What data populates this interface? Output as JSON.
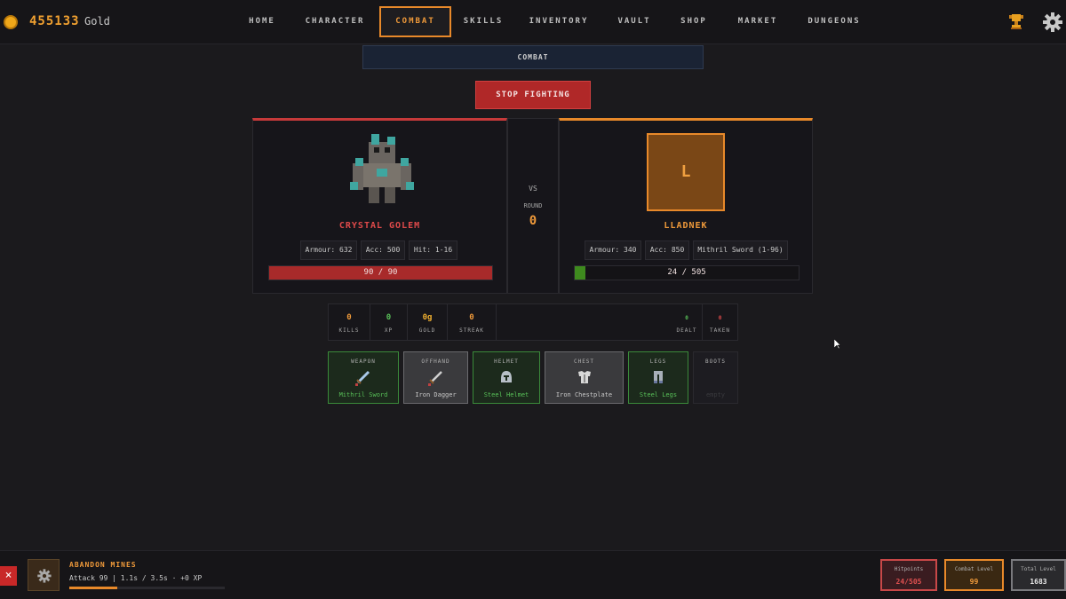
{
  "header": {
    "gold_amount": "455133",
    "gold_label": "Gold",
    "nav": [
      {
        "label": "HOME",
        "active": false
      },
      {
        "label": "CHARACTER",
        "active": false
      },
      {
        "label": "COMBAT",
        "active": true
      },
      {
        "label": "SKILLS",
        "active": false
      },
      {
        "label": "INVENTORY",
        "active": false
      },
      {
        "label": "VAULT",
        "active": false
      },
      {
        "label": "SHOP",
        "active": false
      },
      {
        "label": "MARKET",
        "active": false
      },
      {
        "label": "DUNGEONS",
        "active": false
      }
    ]
  },
  "combat": {
    "header_title": "COMBAT",
    "stop_label": "STOP FIGHTING",
    "vs_label": "VS",
    "round_label": "ROUND",
    "round_value": "0",
    "enemy": {
      "name": "CRYSTAL GOLEM",
      "armour": "Armour: 632",
      "acc": "Acc: 500",
      "hit": "Hit: 1-16",
      "hp_text": "90 / 90",
      "hp_fraction": 1.0,
      "color": "#c73a3a"
    },
    "player": {
      "avatar_letter": "L",
      "name": "LLADNEK",
      "armour": "Armour: 340",
      "acc": "Acc: 850",
      "weapon": "Mithril Sword (1-96)",
      "hp_text": "24 / 505",
      "hp_fraction": 0.0475,
      "color": "#e8892a"
    }
  },
  "stats": {
    "kills": {
      "value": "0",
      "label": "KILLS"
    },
    "xp": {
      "value": "0",
      "label": "XP"
    },
    "gold": {
      "value": "0g",
      "label": "GOLD"
    },
    "streak": {
      "value": "0",
      "label": "STREAK"
    },
    "dealt": {
      "value": "0",
      "label": "DEALT"
    },
    "taken": {
      "value": "0",
      "label": "TAKEN"
    }
  },
  "equipment": [
    {
      "slot": "WEAPON",
      "name": "Mithril Sword",
      "style": "green",
      "icon": "sword-icon"
    },
    {
      "slot": "OFFHAND",
      "name": "Iron Dagger",
      "style": "gray",
      "icon": "dagger-icon"
    },
    {
      "slot": "HELMET",
      "name": "Steel Helmet",
      "style": "green",
      "icon": "helmet-icon"
    },
    {
      "slot": "CHEST",
      "name": "Iron Chestplate",
      "style": "gray",
      "icon": "chestplate-icon"
    },
    {
      "slot": "LEGS",
      "name": "Steel Legs",
      "style": "green",
      "icon": "legs-icon"
    },
    {
      "slot": "BOOTS",
      "name": "empty",
      "style": "empty",
      "icon": ""
    }
  ],
  "activity": {
    "close_label": "×",
    "title": "ABANDON MINES",
    "desc": "Attack 99 | 1.1s / 3.5s · +0 XP",
    "progress_fraction": 0.31
  },
  "levels": {
    "hitpoints": {
      "label": "Hitpoints",
      "value": "24/505"
    },
    "combat": {
      "label": "Combat Level",
      "value": "99"
    },
    "total": {
      "label": "Total Level",
      "value": "1683"
    }
  },
  "colors": {
    "accent": "#e8892a",
    "danger": "#c73a3a",
    "success": "#58c058"
  }
}
